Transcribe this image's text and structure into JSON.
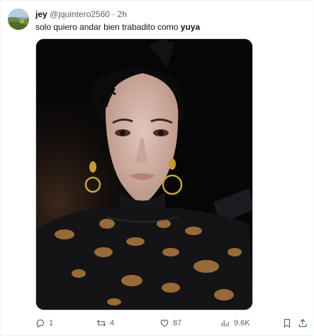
{
  "tweet": {
    "display_name": "jey",
    "handle": "@jquintero2560",
    "separator": "·",
    "time": "2h",
    "text_prefix": "solo quiero andar bien trabadito como ",
    "text_bold": "yuya"
  },
  "actions": {
    "reply_count": "1",
    "retweet_count": "4",
    "like_count": "87",
    "views_count": "9.6K"
  },
  "icons": {
    "reply": "reply-icon",
    "retweet": "retweet-icon",
    "like": "heart-icon",
    "views": "views-icon",
    "bookmark": "bookmark-icon",
    "share": "share-icon"
  },
  "colors": {
    "text_primary": "#0f1419",
    "text_secondary": "#536471",
    "border": "#eff3f4"
  }
}
